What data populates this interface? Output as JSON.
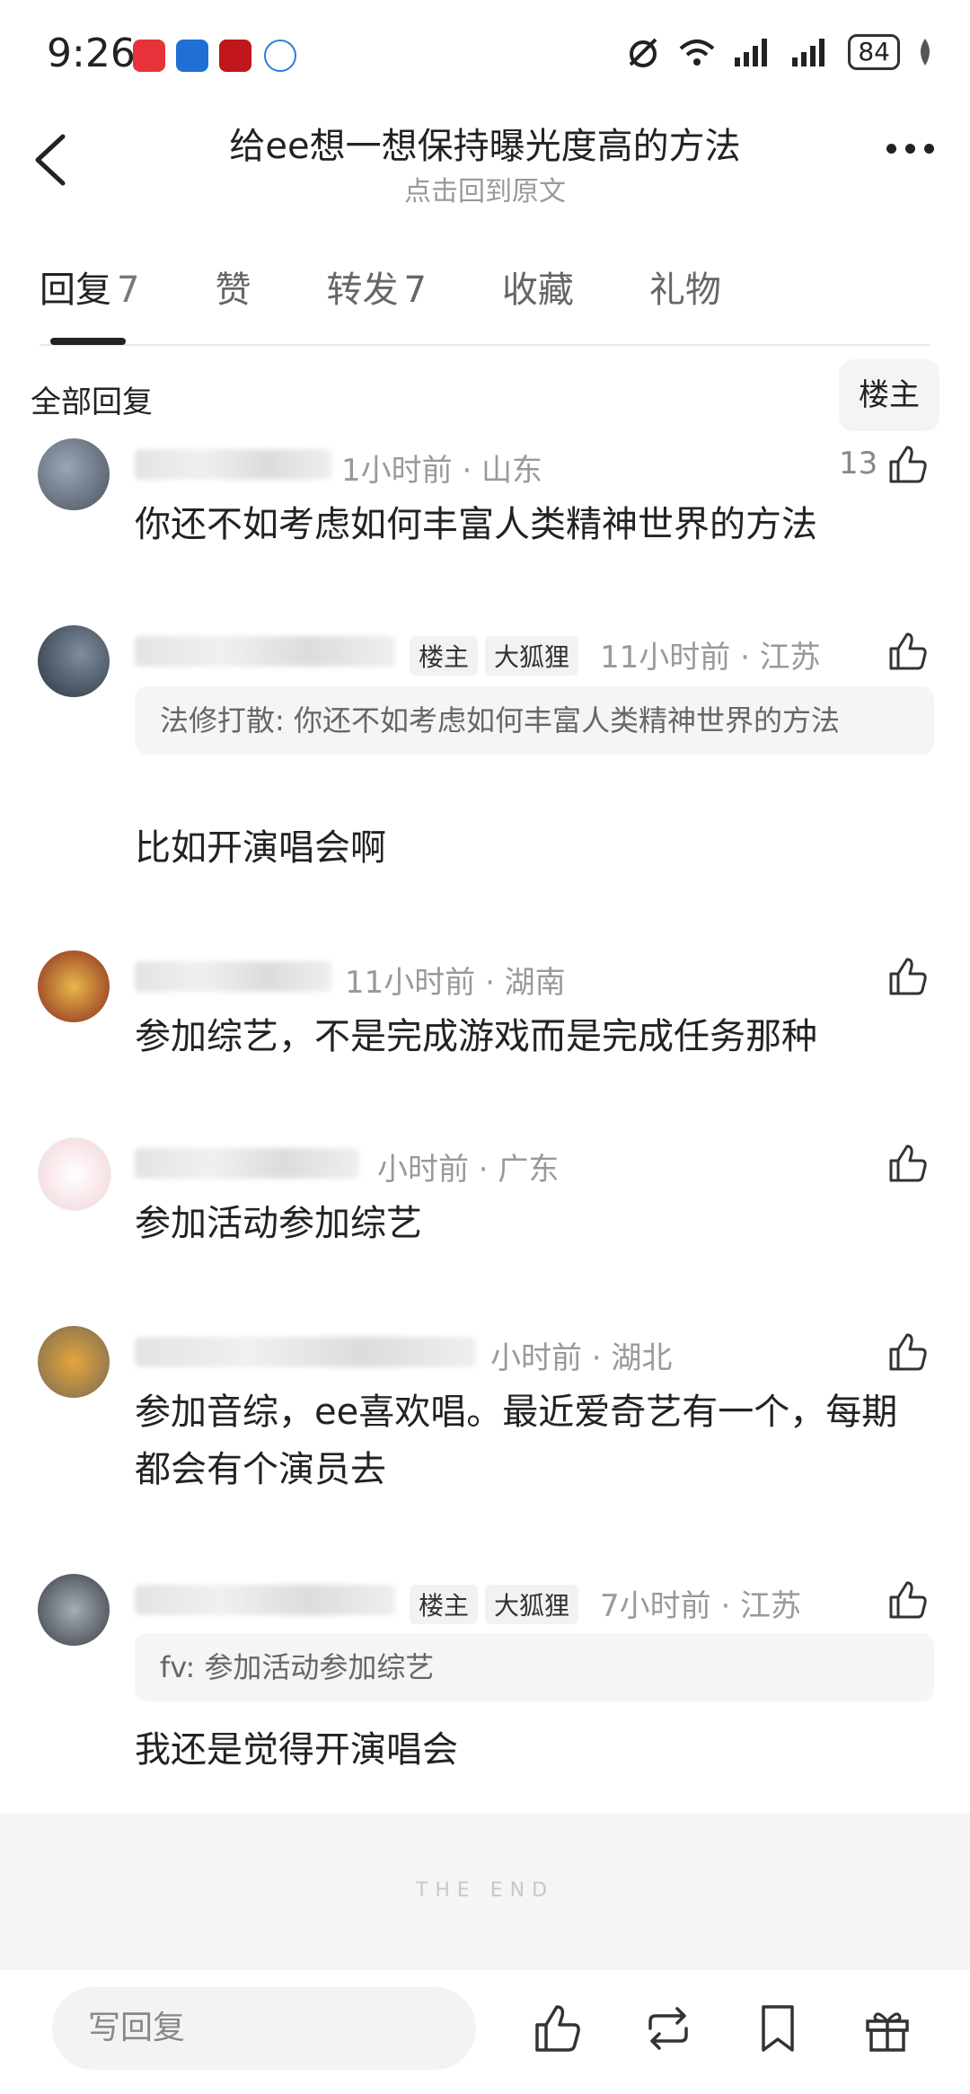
{
  "status_bar": {
    "time": "9:26",
    "battery": "84",
    "app_icons": [
      "huawei-app-icon",
      "fund-app-icon",
      "stock-app-icon",
      "browser-app-icon"
    ]
  },
  "header": {
    "title": "给ee想一想保持曝光度高的方法",
    "subtitle": "点击回到原文"
  },
  "tabs": [
    {
      "label": "回复",
      "count": "7"
    },
    {
      "label": "赞",
      "count": ""
    },
    {
      "label": "转发",
      "count": "7"
    },
    {
      "label": "收藏",
      "count": ""
    },
    {
      "label": "礼物",
      "count": ""
    }
  ],
  "filter": {
    "all_label": "全部回复",
    "op_label": "楼主"
  },
  "comments": [
    {
      "meta": "1小时前 · 山东",
      "likes": "13",
      "text": "你还不如考虑如何丰富人类精神世界的方法"
    },
    {
      "badges": [
        "楼主",
        "大狐狸"
      ],
      "meta": "11小时前 · 江苏",
      "quote": "法修打散: 你还不如考虑如何丰富人类精神世界的方法",
      "text": "比如开演唱会啊"
    },
    {
      "meta": "11小时前 · 湖南",
      "text": "参加综艺，不是完成游戏而是完成任务那种"
    },
    {
      "meta": "小时前 · 广东",
      "text": "参加活动参加综艺"
    },
    {
      "meta": "小时前 · 湖北",
      "text": "参加音综，ee喜欢唱。最近爱奇艺有一个，每期都会有个演员去"
    },
    {
      "badges": [
        "楼主",
        "大狐狸"
      ],
      "meta": "7小时前 · 江苏",
      "quote": "fv: 参加活动参加综艺",
      "text": "我还是觉得开演唱会"
    }
  ],
  "end_text": "THE END",
  "bottom_bar": {
    "reply_placeholder": "写回复"
  },
  "colors": {
    "text": "#222222",
    "secondary": "#999999",
    "quote_bg": "#f5f5f5",
    "input_bg": "#f1f4f2"
  }
}
